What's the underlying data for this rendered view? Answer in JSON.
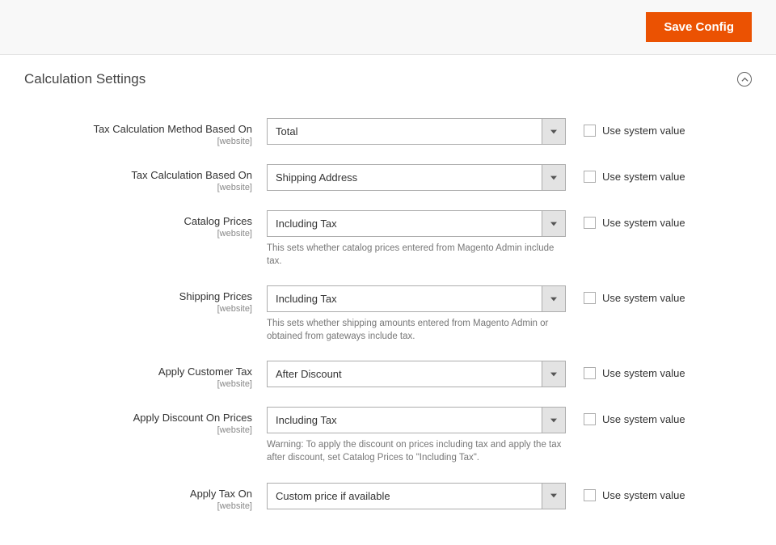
{
  "header": {
    "save_button_label": "Save Config"
  },
  "section": {
    "title": "Calculation Settings"
  },
  "use_system_value_label": "Use system value",
  "scope_label": "[website]",
  "fields": {
    "calc_method": {
      "label": "Tax Calculation Method Based On",
      "value": "Total"
    },
    "calc_based_on": {
      "label": "Tax Calculation Based On",
      "value": "Shipping Address"
    },
    "catalog_prices": {
      "label": "Catalog Prices",
      "value": "Including Tax",
      "help": "This sets whether catalog prices entered from Magento Admin include tax."
    },
    "shipping_prices": {
      "label": "Shipping Prices",
      "value": "Including Tax",
      "help": "This sets whether shipping amounts entered from Magento Admin or obtained from gateways include tax."
    },
    "apply_customer_tax": {
      "label": "Apply Customer Tax",
      "value": "After Discount"
    },
    "apply_discount_on_prices": {
      "label": "Apply Discount On Prices",
      "value": "Including Tax",
      "help": "Warning: To apply the discount on prices including tax and apply the tax after discount, set Catalog Prices to \"Including Tax\"."
    },
    "apply_tax_on": {
      "label": "Apply Tax On",
      "value": "Custom price if available"
    }
  }
}
